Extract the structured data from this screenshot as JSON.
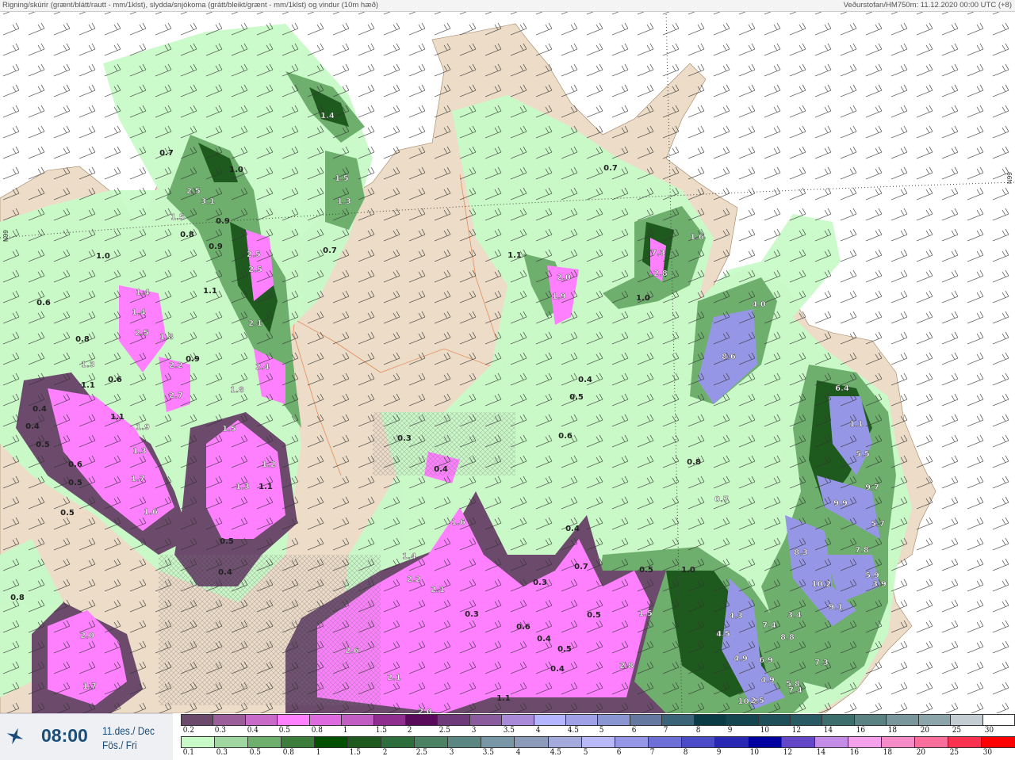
{
  "header": {
    "title": "Rigning/skúrir (grænt/blátt/rautt - mm/1klst), slydda/snjókoma (grátt/bleikt/grænt - mm/1klst) og vindur (10m hæð)",
    "source": "Veðurstofan/HM750m: 11.12.2020 00:00 UTC (+8)"
  },
  "timebox": {
    "icon": "sparkle-compass-icon",
    "time": "08:00",
    "date": "11.des./ Dec",
    "weekday": "Fös./ Fri"
  },
  "map": {
    "grid_labels": [
      "N99",
      "N99"
    ],
    "colors": {
      "land": "#ecdcc8",
      "sea": "#ffffff",
      "roads": "#e07a40",
      "light_green": "#c8fac8",
      "purple": "#ff80ff"
    },
    "labels": [
      "1.4",
      "0.7",
      "1.0",
      "1.5",
      "1.3",
      "2.5",
      "3.1",
      "1.5",
      "0.9",
      "0.8",
      "0.9",
      "2.5",
      "2.5",
      "0.7",
      "1.0",
      "0.6",
      "1.4",
      "1.4",
      "1.1",
      "2.1",
      "0.8",
      "2.5",
      "1.8",
      "2.2",
      "0.9",
      "2.4",
      "1.3",
      "1.1",
      "0.6",
      "2.7",
      "1.8",
      "0.4",
      "1.1",
      "0.4",
      "1.9",
      "1.5",
      "0.5",
      "1.3",
      "0.6",
      "1.2",
      "1.7",
      "0.5",
      "1.3",
      "1.1",
      "1.6",
      "0.5",
      "0.5",
      "0.4",
      "0.8",
      "2.0",
      "1.7",
      "0.7",
      "1.6",
      "1.1",
      "7.3",
      "2.0",
      "1.9",
      "2.8",
      "1.0",
      "4.0",
      "8.6",
      "0.4",
      "0.5",
      "0.6",
      "0.3",
      "0.4",
      "0.8",
      "0.7",
      "1.6",
      "0.4",
      "1.4",
      "2.2",
      "2.1",
      "0.5",
      "1.0",
      "0.7",
      "0.3",
      "0.3",
      "1.5",
      "0.5",
      "0.6",
      "0.4",
      "0.5",
      "2.6",
      "2.8",
      "0.4",
      "2.1",
      "1.1",
      "2.0",
      "6.4",
      "1.1",
      "5.5",
      "9.7",
      "9.9",
      "5.7",
      "8.3",
      "7.8",
      "10.2",
      "5.9",
      "3.9",
      "9.1",
      "3.4",
      "7.4",
      "8.8",
      "7.3",
      "6.9",
      "4.9",
      "4.5",
      "4.3",
      "4.9",
      "5.8",
      "7.4",
      "10.2",
      "2.5"
    ]
  },
  "legend": {
    "snow": {
      "labels": [
        "0.2",
        "0.3",
        "0.4",
        "0.5",
        "0.8",
        "1",
        "1.5",
        "2",
        "2.5",
        "3",
        "3.5",
        "4",
        "4.5",
        "5",
        "6",
        "7",
        "8",
        "9",
        "10",
        "12",
        "14",
        "16",
        "18",
        "20",
        "25",
        "30"
      ],
      "colors": [
        "#6b4a6b",
        "#9b5e9b",
        "#c86ac8",
        "#ff80ff",
        "#dd6adf",
        "#c25ec3",
        "#8f2e8f",
        "#5a0a5a",
        "#6e3a7a",
        "#8a5c9e",
        "#a88ad8",
        "#b4b4ff",
        "#a0a0e6",
        "#8a96d2",
        "#6478a0",
        "#3c6478",
        "#0a3c46",
        "#144650",
        "#1e505a",
        "#285a64",
        "#3c6e6e",
        "#5a8282",
        "#78969b",
        "#8ca5aa",
        "#c3cdd2",
        "#ffffff"
      ]
    },
    "rain": {
      "labels": [
        "0.1",
        "0.3",
        "0.5",
        "0.8",
        "1",
        "1.5",
        "2",
        "2.5",
        "3",
        "3.5",
        "4",
        "4.5",
        "5",
        "6",
        "7",
        "8",
        "9",
        "10",
        "12",
        "14",
        "16",
        "18",
        "20",
        "25",
        "30"
      ],
      "colors": [
        "#c8fac8",
        "#a0d7a0",
        "#6eaf6e",
        "#3c7d3c",
        "#005000",
        "#1e5a1e",
        "#2d6e3c",
        "#4b8264",
        "#5a8782",
        "#7896a5",
        "#8c9bb9",
        "#a5aadc",
        "#b9b9fa",
        "#9696e6",
        "#6e6ed7",
        "#4b4bc8",
        "#2828b4",
        "#0000a0",
        "#6446c8",
        "#c38ce6",
        "#f5a0eb",
        "#f58cc8",
        "#fa6e9b",
        "#fa3250",
        "#ff0000"
      ]
    }
  }
}
